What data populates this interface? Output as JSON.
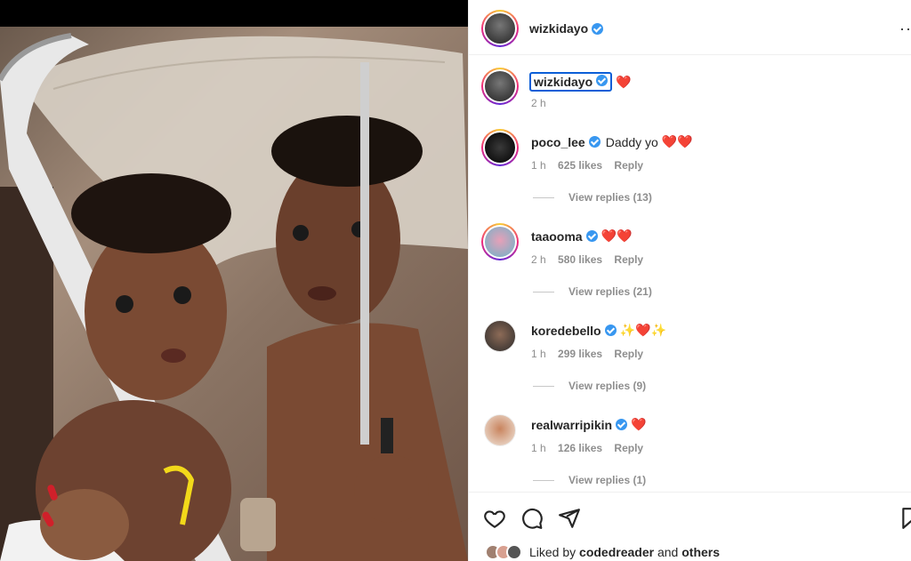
{
  "post": {
    "author": "wizkidayo",
    "caption_author": "wizkidayo",
    "caption_emoji": "❤️",
    "caption_time": "2 h"
  },
  "comments": [
    {
      "user": "poco_lee",
      "text": "Daddy yo",
      "emoji": "❤️❤️",
      "time": "1 h",
      "likes": "625 likes",
      "reply": "Reply",
      "view_replies": "View replies (13)",
      "verified": true
    },
    {
      "user": "taaooma",
      "text": "",
      "emoji": "❤️❤️",
      "time": "2 h",
      "likes": "580 likes",
      "reply": "Reply",
      "view_replies": "View replies (21)",
      "verified": true
    },
    {
      "user": "koredebello",
      "text": "",
      "emoji": "✨❤️✨",
      "time": "1 h",
      "likes": "299 likes",
      "reply": "Reply",
      "view_replies": "View replies (9)",
      "verified": true
    },
    {
      "user": "realwarripikin",
      "text": "",
      "emoji": "❤️",
      "time": "1 h",
      "likes": "126 likes",
      "reply": "Reply",
      "view_replies": "View replies (1)",
      "verified": true
    }
  ],
  "actions": {
    "like_icon": "heart-outline-icon",
    "comment_icon": "comment-bubble-icon",
    "share_icon": "paper-plane-icon",
    "save_icon": "bookmark-icon"
  },
  "likes_summary": {
    "prefix": "Liked by",
    "user": "codedreader",
    "connector": "and",
    "others": "others"
  },
  "colors": {
    "verified": "#3897f0",
    "secondary_text": "#8e8e8e",
    "heart": "#e0245e",
    "focus_outline": "#0b5ed7"
  }
}
